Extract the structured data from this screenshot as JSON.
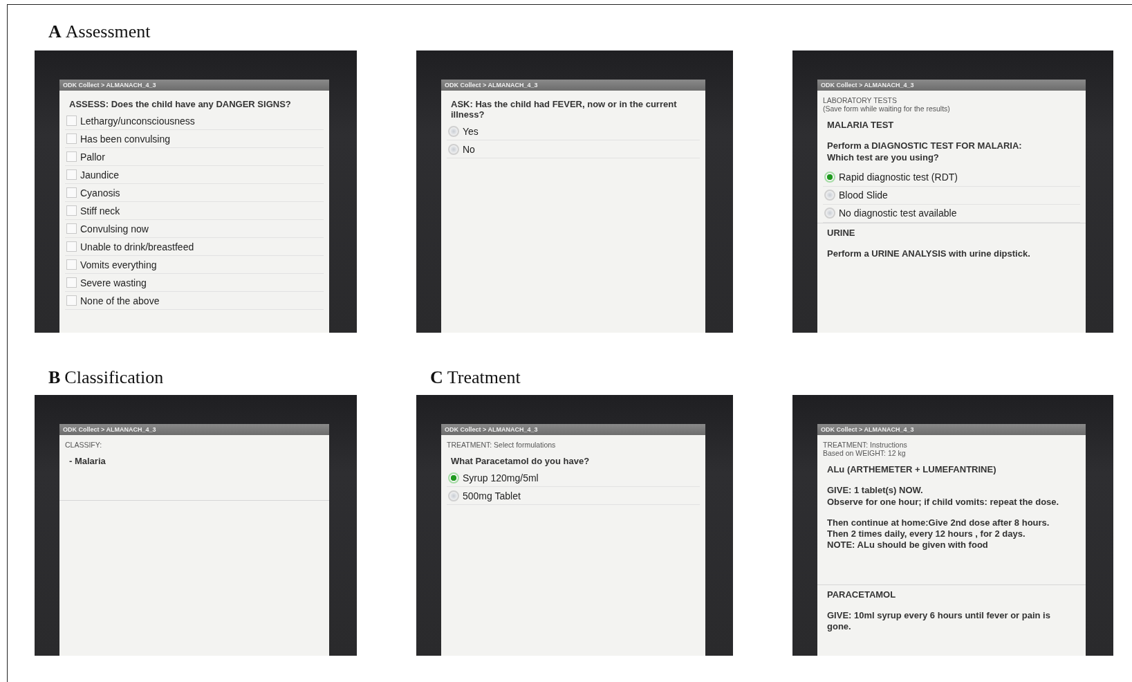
{
  "rows": [
    {
      "panels": [
        {
          "letter": "A",
          "title": "Assessment",
          "screens": [
            {
              "title": "ODK Collect > ALMANACH_4_3",
              "items": [
                {
                  "kind": "question",
                  "text": "ASSESS: Does the child have any DANGER SIGNS?"
                },
                {
                  "kind": "checkbox",
                  "text": "Lethargy/unconsciousness",
                  "checked": false
                },
                {
                  "kind": "checkbox",
                  "text": "Has been convulsing",
                  "checked": false
                },
                {
                  "kind": "checkbox",
                  "text": "Pallor",
                  "checked": false
                },
                {
                  "kind": "checkbox",
                  "text": "Jaundice",
                  "checked": false
                },
                {
                  "kind": "checkbox",
                  "text": "Cyanosis",
                  "checked": false
                },
                {
                  "kind": "checkbox",
                  "text": "Stiff neck",
                  "checked": false
                },
                {
                  "kind": "checkbox",
                  "text": "Convulsing now",
                  "checked": false
                },
                {
                  "kind": "checkbox",
                  "text": "Unable to drink/breastfeed",
                  "checked": false
                },
                {
                  "kind": "checkbox",
                  "text": "Vomits everything",
                  "checked": false
                },
                {
                  "kind": "checkbox",
                  "text": "Severe wasting",
                  "checked": false
                },
                {
                  "kind": "checkbox",
                  "text": "None of the above",
                  "checked": false
                }
              ]
            },
            {
              "title": "ODK Collect > ALMANACH_4_3",
              "items": [
                {
                  "kind": "question",
                  "text": "ASK: Has the child had FEVER, now or in the current illness?"
                },
                {
                  "kind": "radio",
                  "text": "Yes",
                  "selected": false
                },
                {
                  "kind": "radio",
                  "text": "No",
                  "selected": false
                }
              ]
            },
            {
              "title": "ODK Collect > ALMANACH_4_3",
              "items": [
                {
                  "kind": "hint",
                  "text": "LABORATORY TESTS\n(Save form while waiting for the results)"
                },
                {
                  "kind": "text",
                  "text": "MALARIA TEST"
                },
                {
                  "kind": "text",
                  "text": "Perform a DIAGNOSTIC TEST FOR MALARIA:\nWhich test are you using?"
                },
                {
                  "kind": "radio",
                  "text": "Rapid diagnostic test (RDT)",
                  "selected": true
                },
                {
                  "kind": "radio",
                  "text": "Blood Slide",
                  "selected": false
                },
                {
                  "kind": "radio",
                  "text": "No diagnostic test available",
                  "selected": false
                },
                {
                  "kind": "divider"
                },
                {
                  "kind": "text",
                  "text": "URINE"
                },
                {
                  "kind": "text",
                  "text": "Perform a URINE ANALYSIS with urine dipstick."
                }
              ]
            }
          ]
        }
      ]
    },
    {
      "panels": [
        {
          "letter": "B",
          "title": "Classification",
          "screens": [
            {
              "title": "ODK Collect > ALMANACH_4_3",
              "items": [
                {
                  "kind": "hint",
                  "text": "CLASSIFY:"
                },
                {
                  "kind": "text",
                  "text": "- Malaria"
                },
                {
                  "kind": "spacer"
                },
                {
                  "kind": "divider"
                }
              ]
            }
          ]
        },
        {
          "letter": "C",
          "title": "Treatment",
          "screens": [
            {
              "title": "ODK Collect > ALMANACH_4_3",
              "items": [
                {
                  "kind": "hint",
                  "text": "TREATMENT: Select formulations"
                },
                {
                  "kind": "question",
                  "text": "What Paracetamol do you have?"
                },
                {
                  "kind": "radio",
                  "text": "Syrup 120mg/5ml",
                  "selected": true
                },
                {
                  "kind": "radio",
                  "text": "500mg Tablet",
                  "selected": false
                }
              ]
            },
            {
              "title": "ODK Collect > ALMANACH_4_3",
              "items": [
                {
                  "kind": "hint",
                  "text": "TREATMENT: Instructions\nBased on WEIGHT: 12 kg"
                },
                {
                  "kind": "text",
                  "text": "ALu (ARTHEMETER + LUMEFANTRINE)"
                },
                {
                  "kind": "text",
                  "text": "GIVE: 1 tablet(s) NOW.\nObserve for one hour; if child vomits: repeat the dose."
                },
                {
                  "kind": "text",
                  "text": "Then continue at home:Give 2nd dose after 8 hours.\nThen 2 times daily, every 12 hours , for 2 days.\nNOTE: ALu should be given with food"
                },
                {
                  "kind": "spacer"
                },
                {
                  "kind": "divider"
                },
                {
                  "kind": "text",
                  "text": "PARACETAMOL"
                },
                {
                  "kind": "text",
                  "text": "GIVE: 10ml syrup every 6 hours until fever or pain is gone."
                }
              ]
            }
          ]
        }
      ]
    }
  ]
}
